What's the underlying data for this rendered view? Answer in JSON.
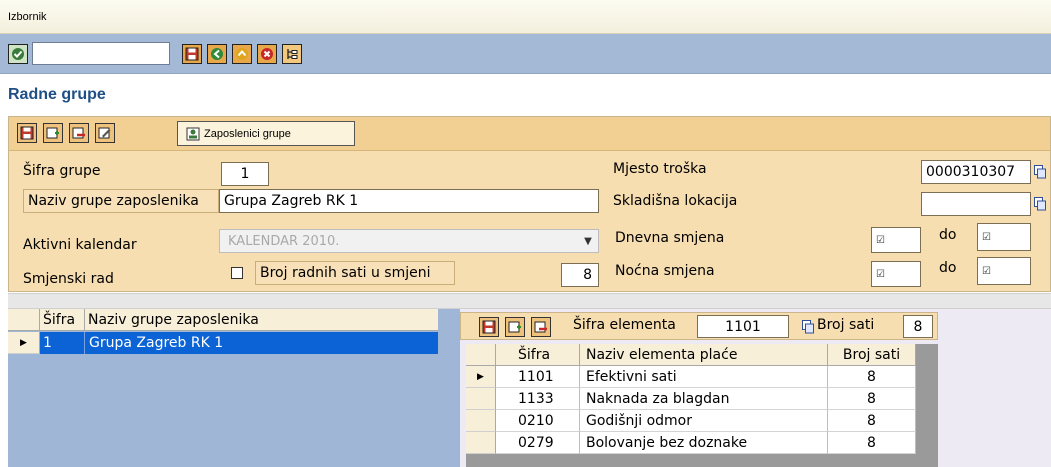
{
  "menu": {
    "label": "Izbornik"
  },
  "toolbar": {
    "command_value": "",
    "icons": [
      "check-icon",
      "save-icon",
      "back-icon",
      "exit-icon",
      "cancel-icon",
      "tree-icon"
    ]
  },
  "page": {
    "title": "Radne grupe"
  },
  "form": {
    "action_button": "Zaposlenici grupe",
    "sifra_grupe_label": "Šifra grupe",
    "sifra_grupe_value": "1",
    "naziv_label": "Naziv grupe zaposlenika",
    "naziv_value": "Grupa Zagreb RK 1",
    "kalendar_label": "Aktivni kalendar",
    "kalendar_value": "KALENDAR 2010.",
    "smjenski_label": "Smjenski rad",
    "broj_sati_label": "Broj radnih sati u smjeni",
    "broj_sati_value": "8",
    "mjesto_label": "Mjesto troška",
    "mjesto_value": "0000310307",
    "skladisna_label": "Skladišna lokacija",
    "skladisna_value": "",
    "dnevna_label": "Dnevna smjena",
    "nocna_label": "Noćna smjena",
    "do_label": "do"
  },
  "groups_grid": {
    "headers": {
      "sifra": "Šifra",
      "naziv": "Naziv grupe zaposlenika"
    },
    "rows": [
      {
        "sifra": "1",
        "naziv": "Grupa Zagreb RK 1"
      }
    ]
  },
  "elements": {
    "sifra_label": "Šifra elementa",
    "sifra_value": "1101",
    "broj_sati_label": "Broj sati",
    "broj_sati_value": "8",
    "headers": {
      "sifra": "Šifra",
      "naziv": "Naziv elementa plaće",
      "broj": "Broj sati"
    },
    "rows": [
      {
        "sifra": "1101",
        "naziv": "Efektivni sati",
        "broj": "8"
      },
      {
        "sifra": "1133",
        "naziv": "Naknada za blagdan",
        "broj": "8"
      },
      {
        "sifra": "0210",
        "naziv": "Godišnji odmor",
        "broj": "8"
      },
      {
        "sifra": "0279",
        "naziv": "Bolovanje bez doznake",
        "broj": "8"
      }
    ]
  }
}
